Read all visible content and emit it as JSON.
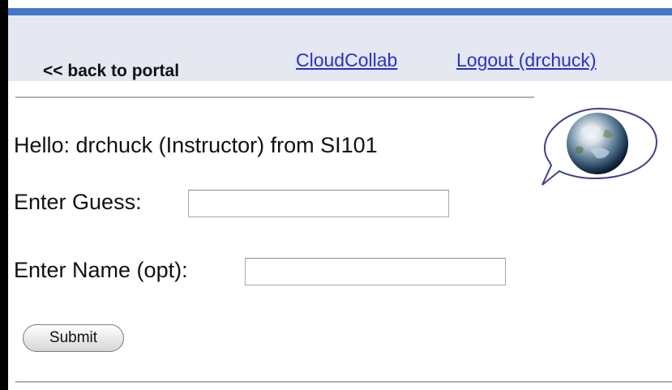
{
  "nav": {
    "back_label": "<< back to portal",
    "cloudcollab_label": "CloudCollab",
    "logout_label": "Logout (drchuck)"
  },
  "greeting": "Hello: drchuck (Instructor) from SI101",
  "form": {
    "guess_label": "Enter Guess:",
    "guess_value": "",
    "name_label": "Enter Name (opt):",
    "name_value": "",
    "submit_label": "Submit"
  },
  "icons": {
    "globe": "globe-speech-bubble-icon"
  },
  "colors": {
    "top_rule": "#3f78c9",
    "navbar_bg": "#e5e7f1",
    "link": "#2631d6"
  }
}
